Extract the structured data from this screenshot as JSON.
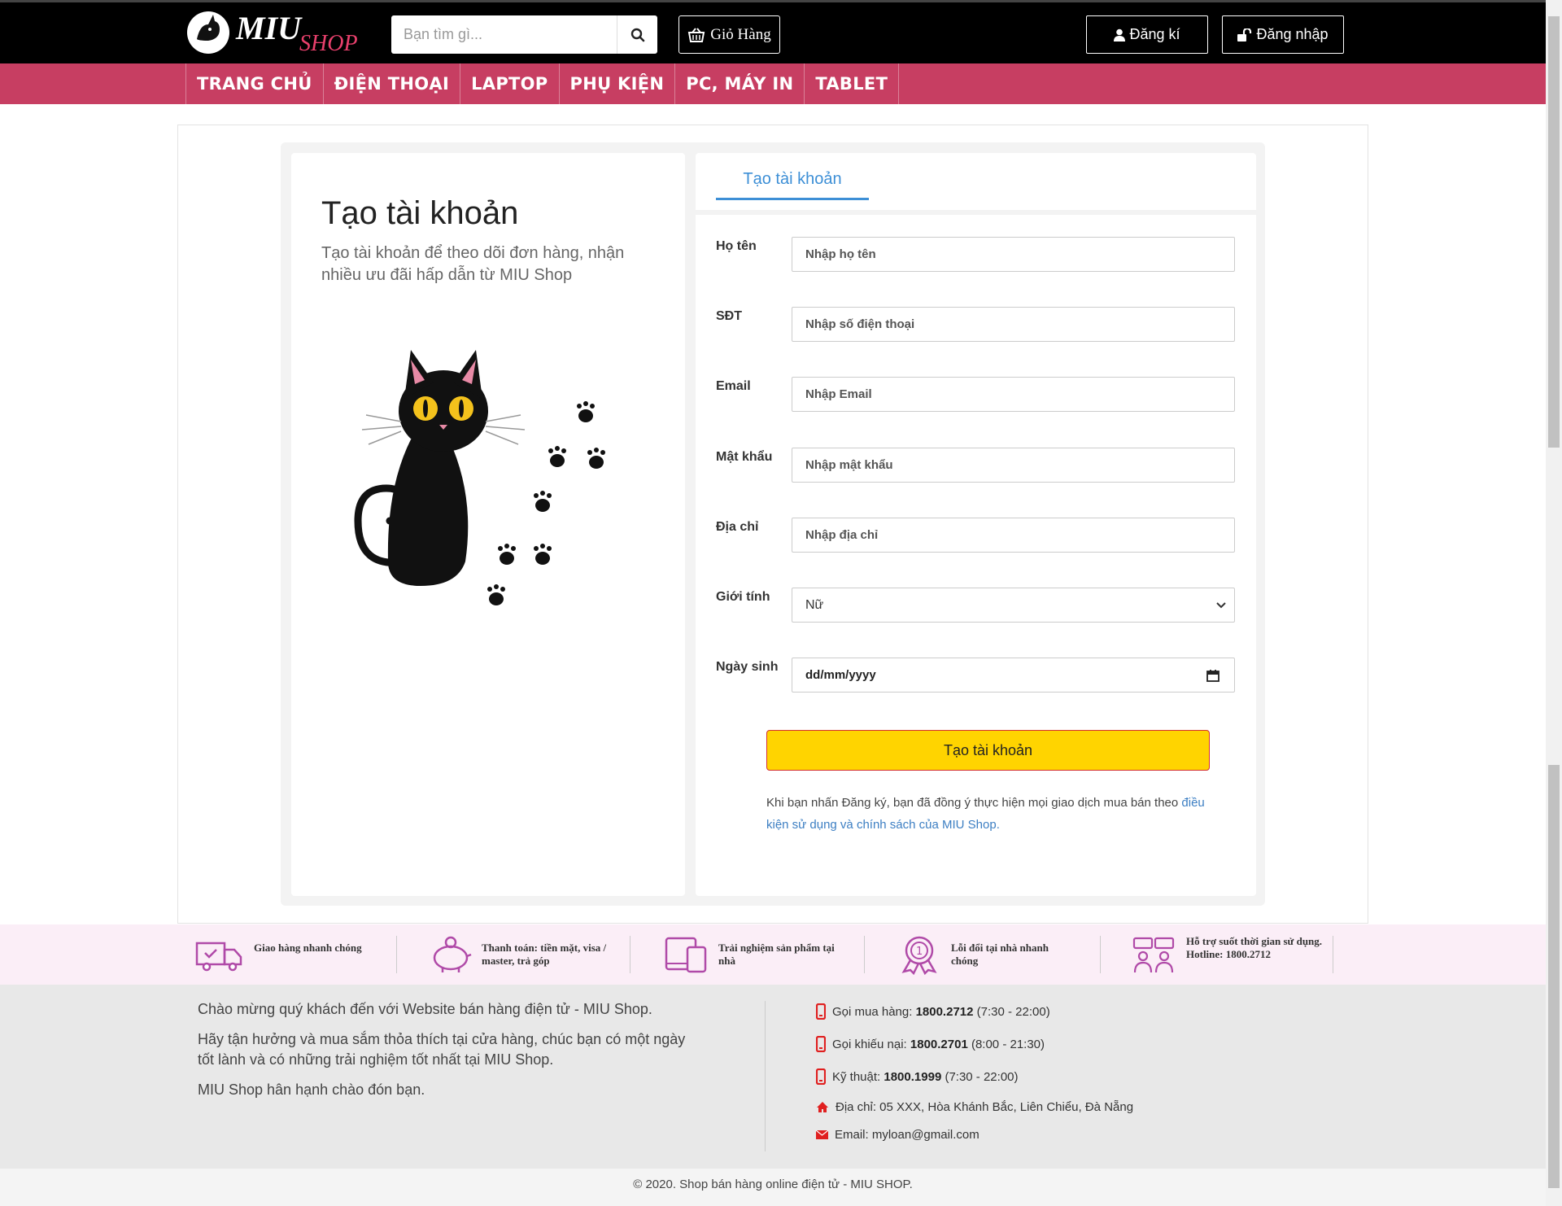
{
  "header": {
    "logo_text_primary": "MIU",
    "logo_text_secondary": "SHOP",
    "search_placeholder": "Bạn tìm gì...",
    "cart_label": "Giỏ Hàng",
    "register_label": "Đăng kí",
    "login_label": "Đăng nhập"
  },
  "nav": {
    "items": [
      "TRANG CHỦ",
      "ĐIỆN THOẠI",
      "LAPTOP",
      "PHỤ KIỆN",
      "PC, MÁY IN",
      "TABLET"
    ]
  },
  "left": {
    "title": "Tạo tài khoản",
    "subtitle": "Tạo tài khoản để theo dõi đơn hàng, nhận nhiều ưu đãi hấp dẫn từ MIU Shop"
  },
  "form": {
    "tab": "Tạo tài khoản",
    "name_label": "Họ tên",
    "name_placeholder": "Nhập họ tên",
    "phone_label": "SĐT",
    "phone_placeholder": "Nhập số điện thoại",
    "email_label": "Email",
    "email_placeholder": "Nhập Email",
    "password_label": "Mật khẩu",
    "password_placeholder": "Nhập mật khẩu",
    "address_label": "Địa chỉ",
    "address_placeholder": "Nhập địa chỉ",
    "gender_label": "Giới tính",
    "gender_value": "Nữ",
    "birthday_label": "Ngày sinh",
    "birthday_value": "dd/mm/yyyy",
    "submit_label": "Tạo tài khoản",
    "terms_text": "Khi bạn nhấn Đăng ký, bạn đã đồng ý thực hiện mọi giao dịch mua bán theo ",
    "terms_link": "điều kiện sử dụng và chính sách của MIU Shop."
  },
  "features": [
    {
      "icon": "delivery-truck-icon",
      "text": "Giao hàng nhanh chóng"
    },
    {
      "icon": "piggy-bank-icon",
      "text": "Thanh toán: tiền mặt, visa / master, trả góp"
    },
    {
      "icon": "devices-icon",
      "text": "Trải nghiệm sản phẩm tại nhà"
    },
    {
      "icon": "medal-icon",
      "text": "Lỗi đổi tại nhà nhanh chóng"
    },
    {
      "icon": "support-chat-icon",
      "text": "Hỗ trợ suốt thời gian sử dụng. Hotline: 1800.2712"
    }
  ],
  "footer": {
    "welcome": "Chào mừng quý khách đến với Website bán hàng điện tử - MIU Shop.",
    "enjoy": "Hãy tận hưởng và mua sắm thỏa thích tại cửa hàng, chúc bạn có một ngày tốt lành và có những trải nghiệm tốt nhất tại MIU Shop.",
    "greeting": "MIU Shop hân hạnh chào đón bạn.",
    "contacts": [
      {
        "icon": "phone-icon",
        "label": "Gọi mua hàng: ",
        "value": "1800.2712",
        "suffix": " (7:30 - 22:00)"
      },
      {
        "icon": "phone-icon",
        "label": "Gọi khiếu nại: ",
        "value": "1800.2701",
        "suffix": " (8:00 - 21:30)"
      },
      {
        "icon": "phone-icon",
        "label": "Kỹ thuật: ",
        "value": "1800.1999",
        "suffix": " (7:30 - 22:00)"
      },
      {
        "icon": "home-icon",
        "label": "Địa chỉ: 05 XXX, Hòa Khánh Bắc, Liên Chiểu, Đà Nẵng",
        "value": "",
        "suffix": ""
      },
      {
        "icon": "envelope-icon",
        "label": "Email: myloan@gmail.com",
        "value": "",
        "suffix": ""
      }
    ],
    "copyright": "© 2020. Shop bán hàng online điện tử - MIU SHOP."
  },
  "colors": {
    "header_bg": "#000000",
    "nav_bg": "#c73e62",
    "accent_blue": "#3d8fd6",
    "submit_bg": "#ffd400",
    "submit_border": "#d32f2f",
    "icon_red": "#e02020",
    "features_bg": "#fbeef7",
    "footer_bg": "#e8e8e8"
  }
}
